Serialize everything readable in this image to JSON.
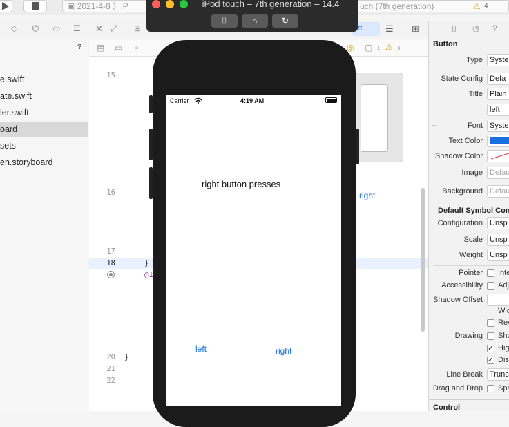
{
  "toolbar": {
    "scheme": "2021-4-8",
    "scheme_target": "iP",
    "device_crumb": "uch (7th generation)",
    "warning_count": "4"
  },
  "navigator": {
    "help": "?",
    "items": [
      {
        "label": "e.swift",
        "selected": false
      },
      {
        "label": "ate.swift",
        "selected": false
      },
      {
        "label": "ler.swift",
        "selected": false
      },
      {
        "label": "oard",
        "selected": true
      },
      {
        "label": "sets",
        "selected": false
      },
      {
        "label": "en.storyboard",
        "selected": false
      }
    ]
  },
  "editor": {
    "lines": [
      {
        "num": "15",
        "code": ""
      },
      {
        "num": "16",
        "code": ""
      },
      {
        "num": "17",
        "code": ""
      },
      {
        "num": "18",
        "code": "}"
      },
      {
        "num": "",
        "code": "@I"
      },
      {
        "num": "20",
        "code": "}"
      },
      {
        "num": "21",
        "code": ""
      },
      {
        "num": "22",
        "code": ""
      }
    ],
    "canvas_right_label": "right"
  },
  "simulator": {
    "title": "iPod touch – 7th generation – 14.4",
    "status_carrier": "Carrier",
    "status_time": "4:19 AM",
    "message": "right button presses",
    "left_button": "left",
    "right_button": "right"
  },
  "inspector": {
    "section_button": "Button",
    "type_label": "Type",
    "type_value": "Syste",
    "state_config_label": "State Config",
    "state_config_value": "Defa",
    "title_label": "Title",
    "title_value": "Plain",
    "title_text": "left",
    "font_label": "Font",
    "font_value": "Syste",
    "text_color_label": "Text Color",
    "text_color": "#1a6fe0",
    "shadow_color_label": "Shadow Color",
    "image_label": "Image",
    "image_placeholder": "Defau",
    "background_label": "Background",
    "background_placeholder": "Defau",
    "symbol_section": "Default Symbol Conf",
    "configuration_label": "Configuration",
    "configuration_value": "Unsp",
    "scale_label": "Scale",
    "scale_value": "Unsp",
    "weight_label": "Weight",
    "weight_value": "Unsp",
    "pointer_label": "Pointer",
    "pointer_text": "Inte",
    "accessibility_label": "Accessibility",
    "accessibility_text": "Adj",
    "shadow_offset_label": "Shadow Offset",
    "wid_text": "Wid",
    "rev_text": "Rev",
    "drawing_label": "Drawing",
    "drawing_text": "Sho",
    "hig_text": "Hig",
    "dis_text": "Dis",
    "line_break_label": "Line Break",
    "line_break_value": "Trunc",
    "drag_drop_label": "Drag and Drop",
    "drag_drop_text": "Spr",
    "control_section": "Control"
  }
}
